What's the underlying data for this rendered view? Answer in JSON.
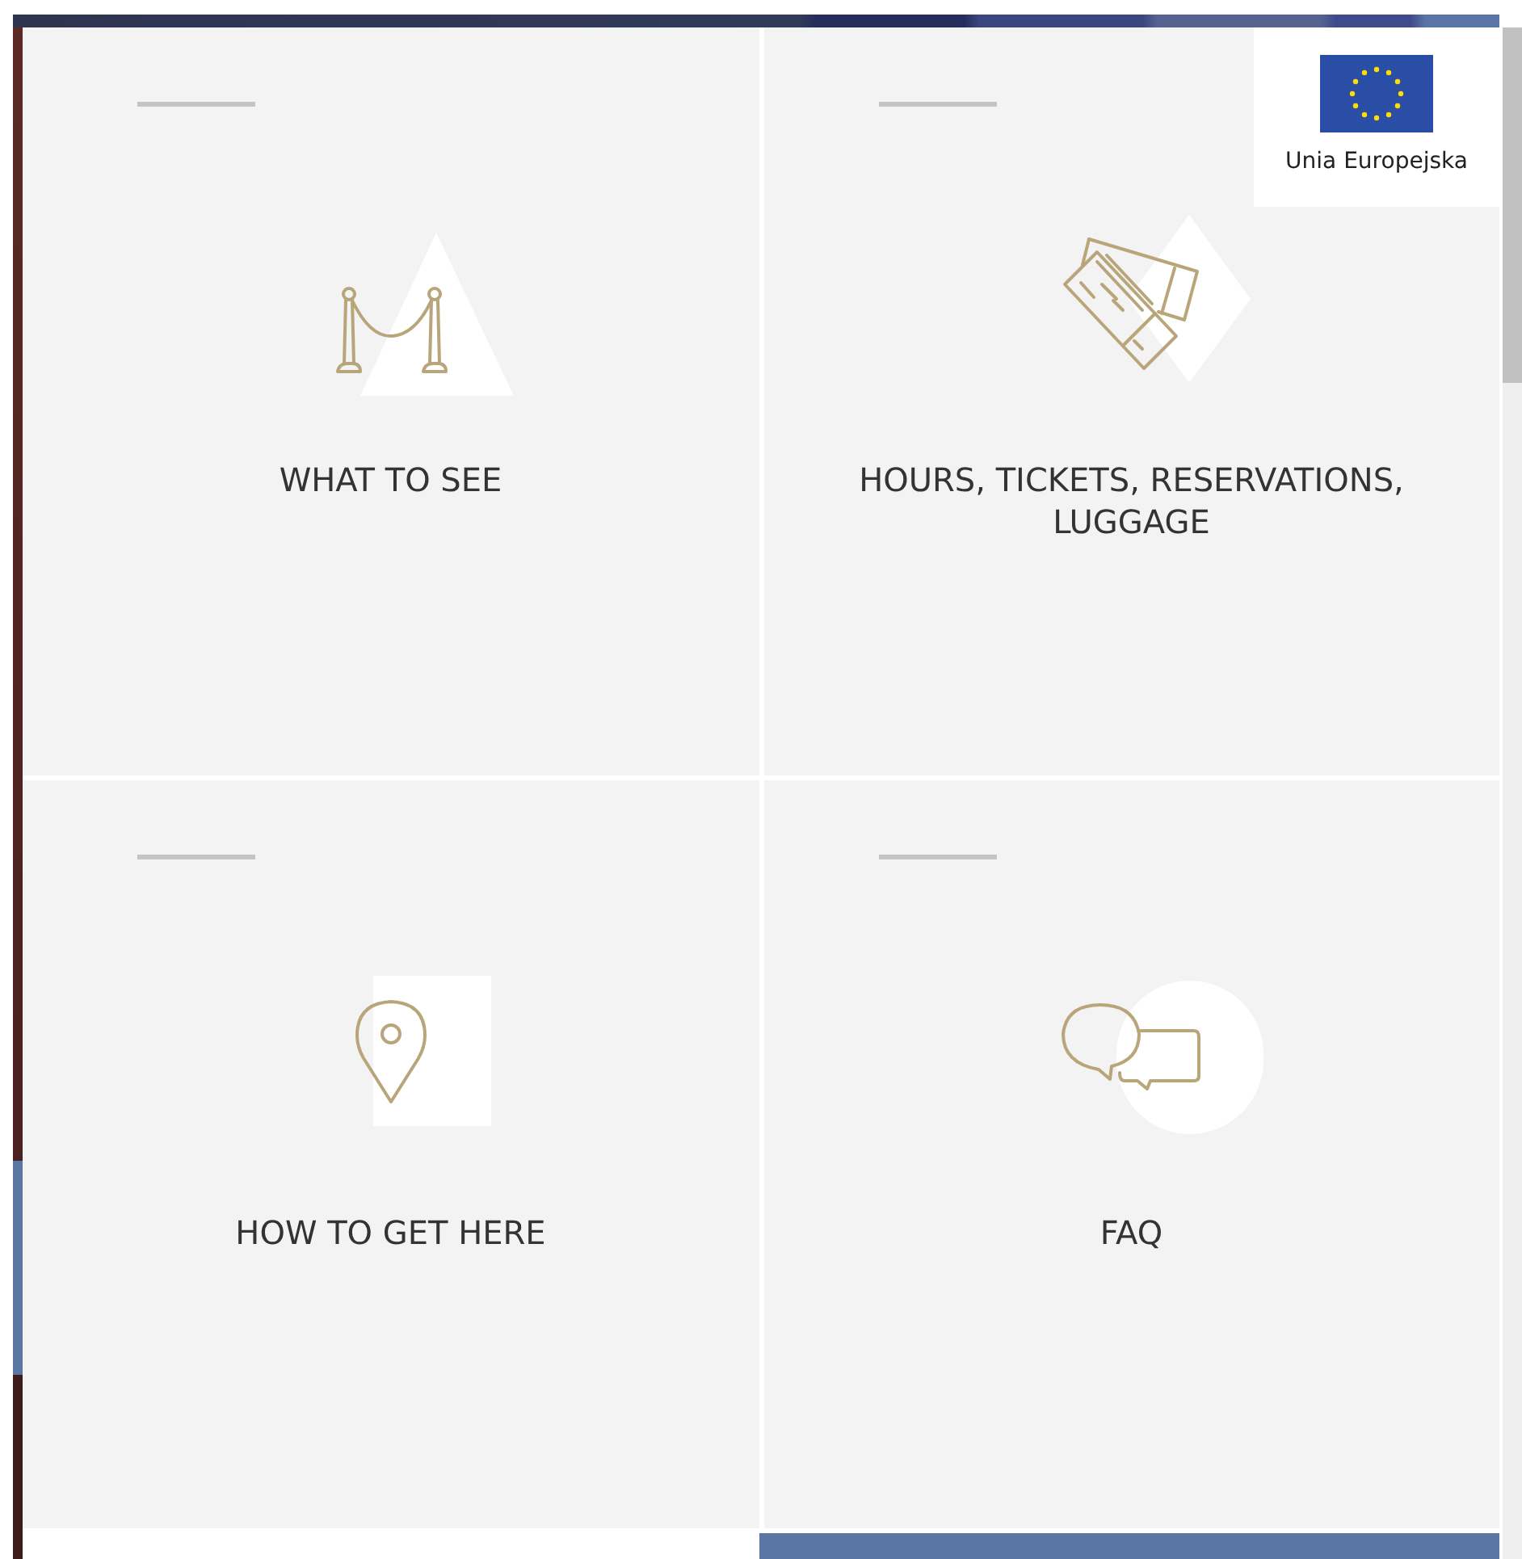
{
  "tiles": [
    {
      "title": "WHAT TO SEE",
      "kind": "rope"
    },
    {
      "title": "HOURS, TICKETS, RESERVATIONS, LUGGAGE",
      "kind": "tickets"
    },
    {
      "title": "HOW TO GET HERE",
      "kind": "pin"
    },
    {
      "title": "FAQ",
      "kind": "chat"
    }
  ],
  "eu_badge": {
    "label": "Unia Europejska"
  }
}
